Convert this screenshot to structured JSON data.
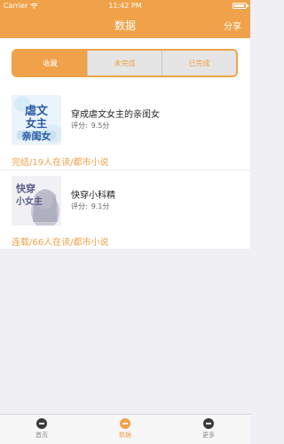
{
  "status": {
    "carrier": "Carrier",
    "time": "11:42 PM"
  },
  "nav": {
    "title": "数据",
    "share": "分享"
  },
  "segments": [
    {
      "label": "收藏",
      "active": true
    },
    {
      "label": "未完成",
      "active": false
    },
    {
      "label": "已完成",
      "active": false
    }
  ],
  "books": [
    {
      "title": "穿成虐文女主的亲闺女",
      "score_label": "评分:",
      "score": "9.5分",
      "meta": "完结/19人在读/都市小说",
      "cover_text": "穿成虐文女主的亲闺女"
    },
    {
      "title": "快穿小科精",
      "score_label": "评分:",
      "score": "9.1分",
      "meta": "连载/66人在读/都市小说",
      "cover_text": "快穿小女主"
    }
  ],
  "tabs": [
    {
      "label": "首页",
      "icon": "home-icon",
      "active": false
    },
    {
      "label": "数据",
      "icon": "data-icon",
      "active": true
    },
    {
      "label": "更多",
      "icon": "more-icon",
      "active": false
    }
  ],
  "colors": {
    "accent": "#f0a24a",
    "background": "#efeff4"
  }
}
